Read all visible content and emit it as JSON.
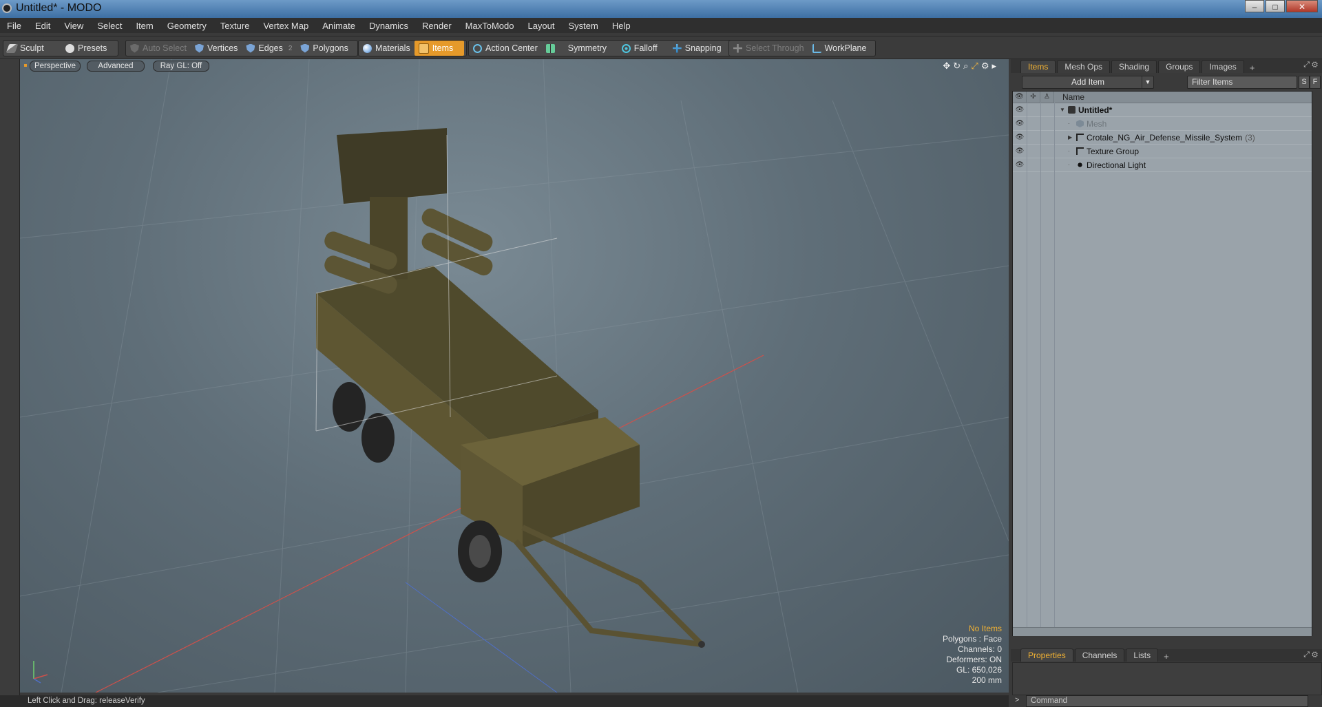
{
  "window": {
    "title": "Untitled* - MODO",
    "min": "–",
    "max": "□",
    "close": "✕"
  },
  "menu": [
    "File",
    "Edit",
    "View",
    "Select",
    "Item",
    "Geometry",
    "Texture",
    "Vertex Map",
    "Animate",
    "Dynamics",
    "Render",
    "MaxToModo",
    "Layout",
    "System",
    "Help"
  ],
  "toolbar": {
    "sculpt": "Sculpt",
    "presets": "Presets",
    "auto_select": "Auto Select",
    "vertices": "Vertices",
    "edges": "Edges",
    "edges_badge": "2",
    "polygons": "Polygons",
    "materials": "Materials",
    "items": "Items",
    "action_center": "Action Center",
    "symmetry": "Symmetry",
    "falloff": "Falloff",
    "snapping": "Snapping",
    "select_through": "Select Through",
    "workplane": "WorkPlane"
  },
  "viewport": {
    "tabs": [
      "Perspective",
      "Advanced",
      "Ray GL: Off"
    ],
    "info": {
      "selection": "No Items",
      "polygons": "Polygons : Face",
      "channels": "Channels: 0",
      "deformers": "Deformers: ON",
      "gl": "GL: 650,026",
      "scale": "200 mm"
    },
    "axes": {
      "y": "Y",
      "x": "X",
      "z": "Z"
    }
  },
  "status": "Left Click and Drag:  releaseVerify",
  "items_panel": {
    "tabs": [
      "Items",
      "Mesh Ops",
      "Shading",
      "Groups",
      "Images"
    ],
    "add_item": "Add Item",
    "filter_placeholder": "Filter Items",
    "btn_s": "S",
    "btn_f": "F",
    "column_name": "Name",
    "tree": [
      {
        "label": "Untitled*",
        "type": "scene",
        "expanded": true
      },
      {
        "label": "Mesh",
        "type": "mesh",
        "dim": true
      },
      {
        "label": "Crotale_NG_Air_Defense_Missile_System",
        "count": "(3)",
        "type": "locator"
      },
      {
        "label": "Texture Group",
        "type": "group"
      },
      {
        "label": "Directional Light",
        "type": "light"
      }
    ]
  },
  "properties_panel": {
    "tabs": [
      "Properties",
      "Channels",
      "Lists"
    ],
    "command_placeholder": "Command",
    "prompt": ">"
  },
  "colors": {
    "accent": "#e69a2a",
    "viewport_bg": "#5f6e78",
    "vehicle": "#5a5230",
    "x_axis": "#d0504a",
    "z_axis": "#4f6fc8"
  }
}
